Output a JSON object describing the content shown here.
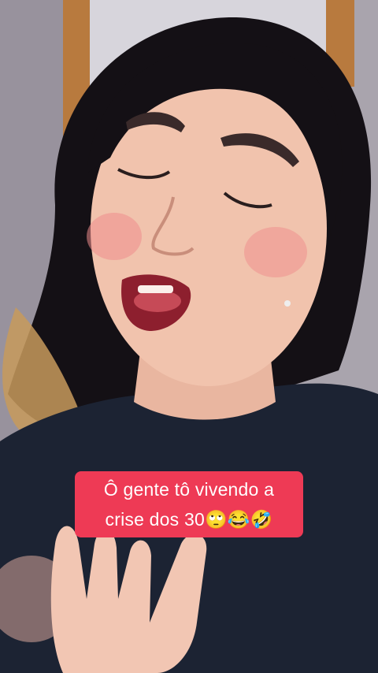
{
  "video": {
    "caption_line_1": "Ô gente tô vivendo a",
    "caption_line_2": "crise dos 30🙄😂🤣"
  },
  "colors": {
    "caption_background": "#ee3a55",
    "caption_text": "#ffffff",
    "shirt": "#1c2333",
    "hair": "#141015"
  }
}
